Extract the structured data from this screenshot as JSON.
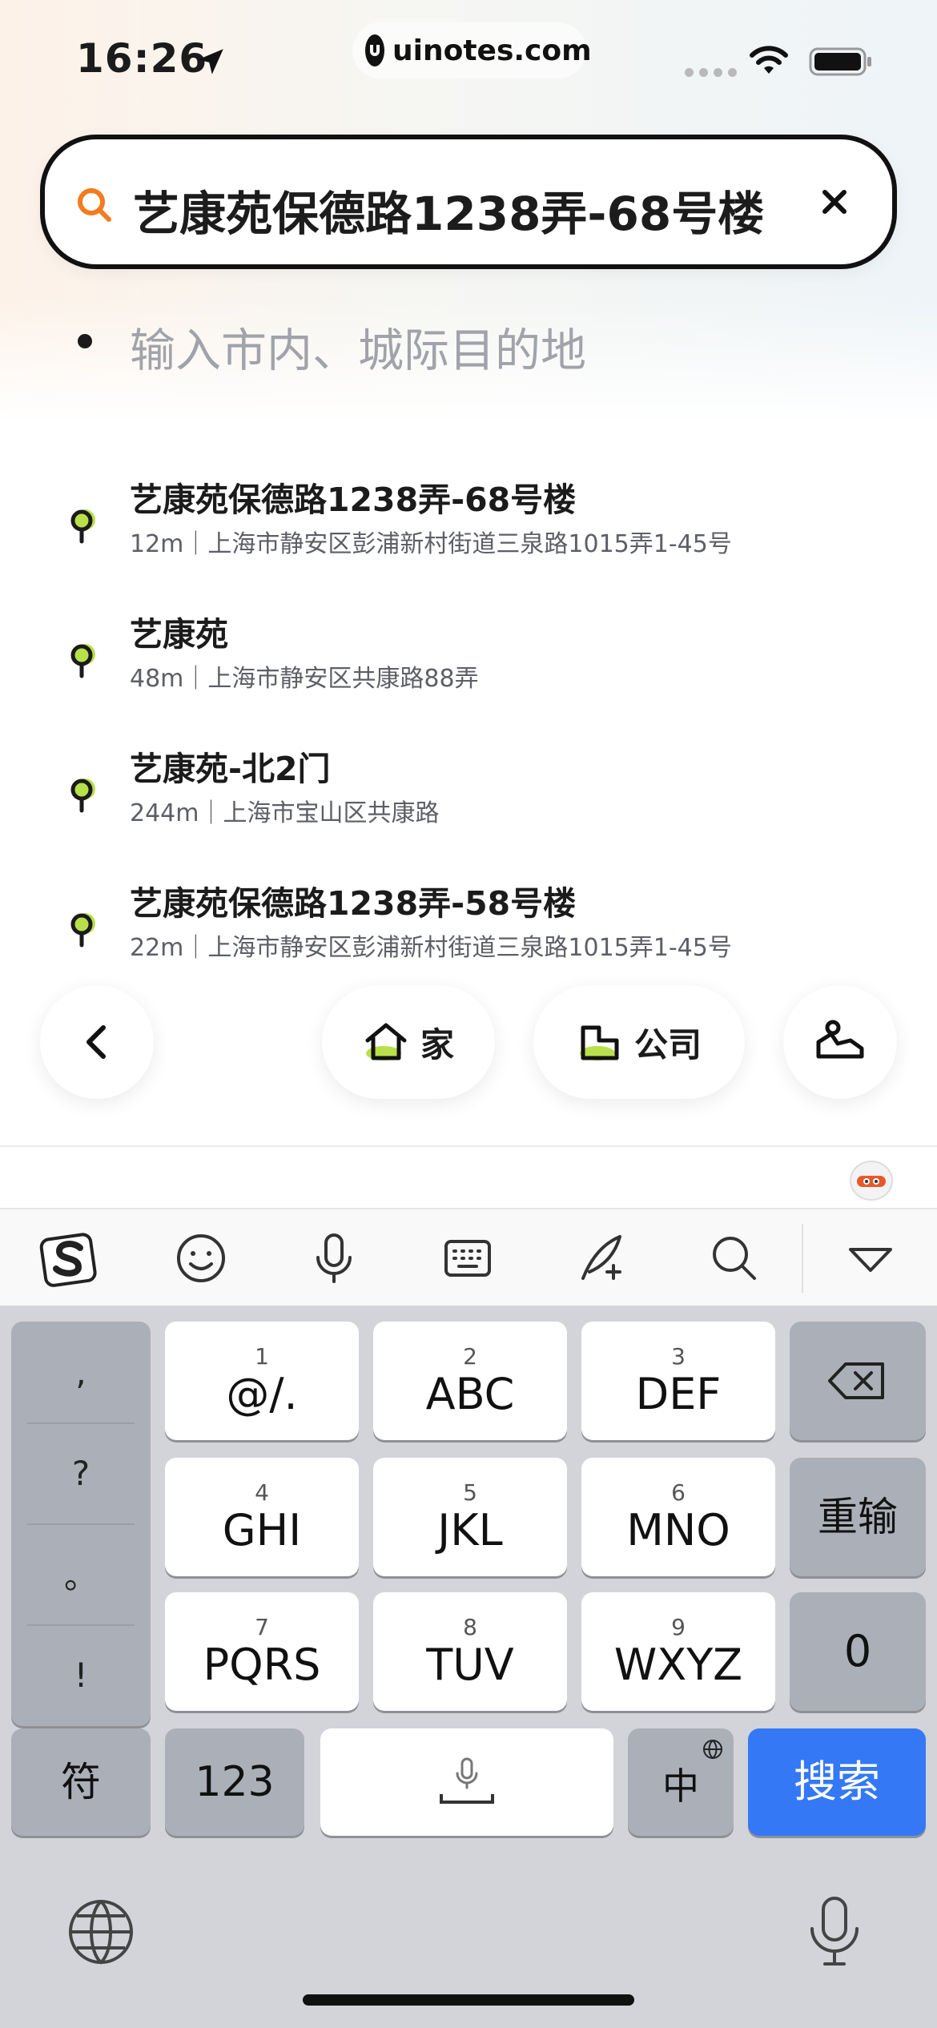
{
  "status_bar": {
    "time": "16:26",
    "url": "uinotes.com"
  },
  "search": {
    "query": "艺康苑保德路1238弄-68号楼",
    "destination_placeholder": "输入市内、城际目的地"
  },
  "results": [
    {
      "title": "艺康苑保德路1238弄-68号楼",
      "subtitle": "12m｜上海市静安区彭浦新村街道三泉路1015弄1-45号"
    },
    {
      "title": "艺康苑",
      "subtitle": "48m｜上海市静安区共康路88弄"
    },
    {
      "title": "艺康苑-北2门",
      "subtitle": "244m｜上海市宝山区共康路"
    },
    {
      "title": "艺康苑保德路1238弄-58号楼",
      "subtitle": "22m｜上海市静安区彭浦新村街道三泉路1015弄1-45号"
    }
  ],
  "quick": {
    "home_label": "家",
    "company_label": "公司"
  },
  "keyboard": {
    "punct": [
      ",",
      "?",
      "。",
      "!"
    ],
    "keys": [
      {
        "num": "1",
        "label": "@/."
      },
      {
        "num": "2",
        "label": "ABC"
      },
      {
        "num": "3",
        "label": "DEF"
      },
      {
        "num": "4",
        "label": "GHI"
      },
      {
        "num": "5",
        "label": "JKL"
      },
      {
        "num": "6",
        "label": "MNO"
      },
      {
        "num": "7",
        "label": "PQRS"
      },
      {
        "num": "8",
        "label": "TUV"
      },
      {
        "num": "9",
        "label": "WXYZ"
      }
    ],
    "reenter": "重输",
    "zero": "0",
    "symbols": "符",
    "numbers": "123",
    "lang": "中",
    "search": "搜索"
  },
  "colors": {
    "accent_orange": "#f47b20",
    "pin_green": "#b8e04a",
    "keyboard_blue": "#3478f6"
  }
}
